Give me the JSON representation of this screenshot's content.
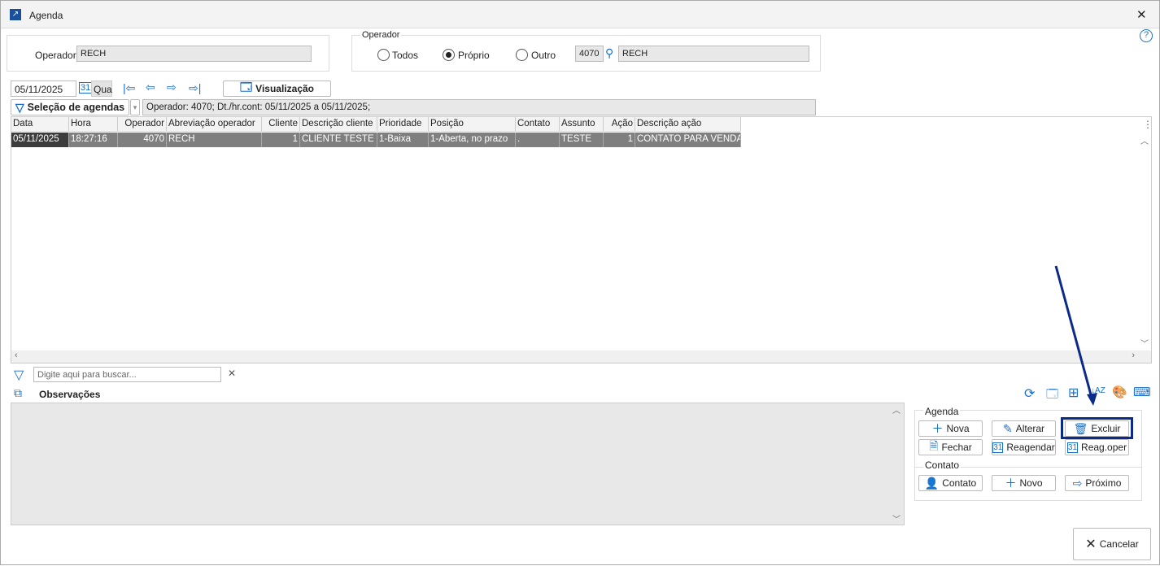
{
  "window": {
    "title": "Agenda",
    "close": "✕",
    "help": "?"
  },
  "operador_panel": {
    "label": "Operador",
    "value": "RECH"
  },
  "operador_group": {
    "title": "Operador",
    "options": [
      "Todos",
      "Próprio",
      "Outro"
    ],
    "selected": "Próprio",
    "code": "4070",
    "name": "RECH"
  },
  "date": {
    "value": "05/11/2025",
    "weekday": "Qua"
  },
  "visualizacao_label": "Visualização",
  "selecao_label": "Seleção de agendas",
  "filter_summary": "Operador: 4070; Dt./hr.cont: 05/11/2025 a 05/11/2025;",
  "table": {
    "columns": [
      "Data",
      "Hora",
      "Operador",
      "Abreviação operador",
      "Cliente",
      "Descrição cliente",
      "Prioridade",
      "Posição",
      "Contato",
      "Assunto",
      "Ação",
      "Descrição ação"
    ],
    "rows": [
      [
        "05/11/2025",
        "18:27:16",
        "4070",
        "RECH",
        "1",
        "CLIENTE TESTE",
        "1-Baixa",
        "1-Aberta, no prazo",
        ".",
        "TESTE",
        "1",
        "CONTATO PARA VENDA"
      ]
    ]
  },
  "search": {
    "placeholder": "Digite aqui para buscar..."
  },
  "observacoes_label": "Observações",
  "agenda_group": {
    "title": "Agenda",
    "buttons": [
      "Nova",
      "Alterar",
      "Excluir",
      "Fechar",
      "Reagendar",
      "Reag.oper"
    ]
  },
  "contato_group": {
    "title": "Contato",
    "buttons": [
      "Contato",
      "Novo",
      "Próximo"
    ]
  },
  "cancel_label": "Cancelar",
  "colors": {
    "accent": "#1a6fc9",
    "highlight": "#0b2a8a",
    "row_selected": "#7f7f7f"
  }
}
